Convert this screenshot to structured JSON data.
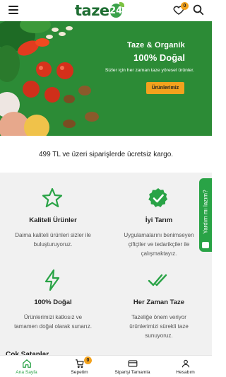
{
  "header": {
    "logo_text": "taze",
    "logo_number": "24",
    "favorites_count": "0"
  },
  "hero": {
    "title": "Taze & Organik",
    "subtitle": "100% Doğal",
    "description": "Sizler için her zaman taze yöresel ürünler.",
    "button_label": "Ürünlerimiz"
  },
  "shipping": {
    "text": "499 TL ve üzeri siparişlerde ücretsiz kargo."
  },
  "features": [
    {
      "title": "Kaliteli Ürünler",
      "desc": "Daima kaliteli ürünleri sizler ile buluşturuyoruz.",
      "icon": "star-icon"
    },
    {
      "title": "İyi Tarım",
      "desc": "Uygulamalarını benimseyen çiftçiler ve tedarikçiler ile çalışmaktayız.",
      "icon": "badge-check-icon"
    },
    {
      "title": "100% Doğal",
      "desc": "Ürünlerimizi katkısız ve tamamen doğal olarak sunarız.",
      "icon": "bolt-icon"
    },
    {
      "title": "Her Zaman Taze",
      "desc": "Tazeliğe önem veriyor ürünlerimizi sürekli taze sunuyoruz.",
      "icon": "double-check-icon"
    }
  ],
  "partial_heading": "Çok Satanlar",
  "side_tab": {
    "label": "Yardım mı lazım?"
  },
  "bottom_nav": {
    "items": [
      {
        "label": "Ana Sayfa",
        "icon": "home-icon"
      },
      {
        "label": "Sepetim",
        "icon": "cart-icon",
        "badge": "0"
      },
      {
        "label": "Siparişi Tamamla",
        "icon": "wallet-icon"
      },
      {
        "label": "Hesabım",
        "icon": "user-icon"
      }
    ]
  },
  "colors": {
    "brand_green": "#29a346",
    "dark_green": "#1f6e33",
    "accent_orange": "#f3a21d"
  }
}
